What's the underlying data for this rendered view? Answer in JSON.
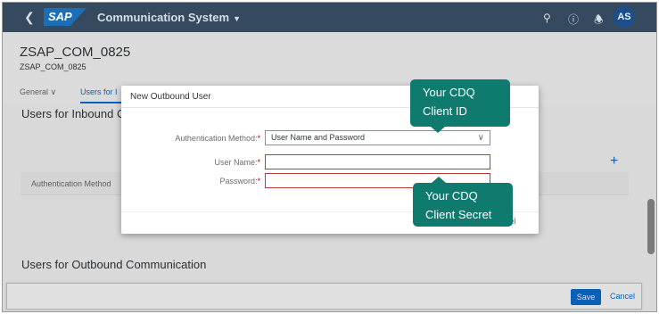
{
  "shell": {
    "back_icon": "chevron-left-icon",
    "logo": "SAP",
    "app_title": "Communication System",
    "icons": [
      "search-icon",
      "help-icon",
      "bell-icon"
    ],
    "avatar": "AS"
  },
  "header": {
    "title": "ZSAP_COM_0825",
    "subtitle": "ZSAP_COM_0825",
    "tabs": [
      {
        "label": "General"
      },
      {
        "label": "Users for I"
      }
    ]
  },
  "sections": {
    "inbound_title": "Users for Inbound Co",
    "auth_column": "Authentication Method",
    "outbound_title": "Users for Outbound Communication"
  },
  "footer": {
    "save_label": "Save",
    "cancel_label": "Cancel"
  },
  "dialog": {
    "title": "New Outbound User",
    "auth_label": "Authentication Method:",
    "auth_value": "User Name and Password",
    "username_label": "User Name:",
    "password_label": "Password:",
    "required_mark": "*",
    "username_value": "",
    "password_value": "",
    "cancel_fragment": "ncel"
  },
  "callouts": {
    "client_id": [
      "Your CDQ",
      "Client ID"
    ],
    "client_secret": [
      "Your CDQ",
      "Client Secret"
    ],
    "color": "#0f7a6e"
  },
  "colors": {
    "shell": "#354a5f",
    "accent": "#0a6ed1",
    "error_border": "#b33b3b"
  }
}
